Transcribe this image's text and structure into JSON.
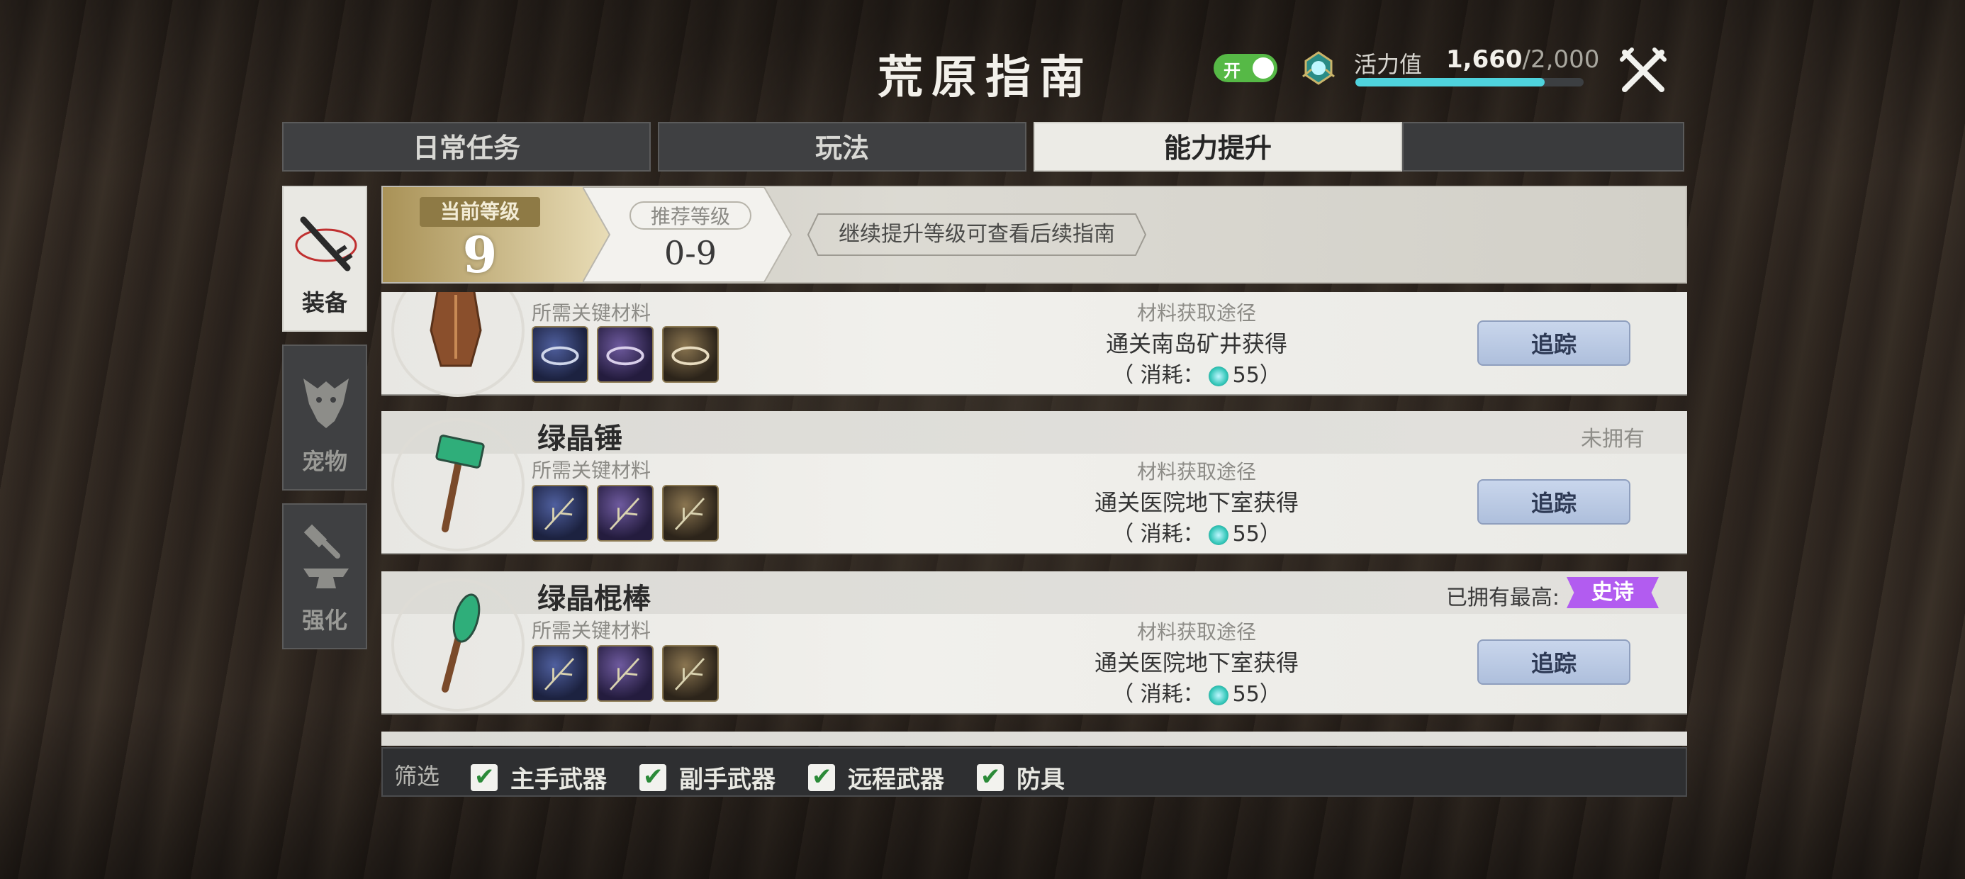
{
  "header": {
    "title": "荒原指南",
    "toggle_label": "开",
    "energy_label": "活力值",
    "energy_current": "1,660",
    "energy_max": "/2,000",
    "energy_fraction": 0.83,
    "icons": {
      "energy": "energy-crystal-icon",
      "close": "crossed-swords-close-icon"
    }
  },
  "tabs": [
    {
      "label": "日常任务",
      "active": false
    },
    {
      "label": "玩法",
      "active": false
    },
    {
      "label": "能力提升",
      "active": true
    }
  ],
  "side_nav": [
    {
      "label": "装备",
      "icon": "sword-icon",
      "active": true
    },
    {
      "label": "宠物",
      "icon": "wolf-icon",
      "active": false
    },
    {
      "label": "强化",
      "icon": "anvil-hammer-icon",
      "active": false
    }
  ],
  "level": {
    "current_label": "当前等级",
    "current_value": "9",
    "recommended_label": "推荐等级",
    "recommended_value": "0-9",
    "hint": "继续提升等级可查看后续指南"
  },
  "items": [
    {
      "name": "",
      "ownership": "",
      "req_label": "所需关键材料",
      "materials": [
        "blue",
        "purple",
        "gold"
      ],
      "source_label": "材料获取途径",
      "source": "通关南岛矿井获得",
      "cost_prefix": "（ 消耗：",
      "cost_value": "55",
      "cost_suffix": "）",
      "track": "追踪",
      "icon": "bracer-icon"
    },
    {
      "name": "绿晶锤",
      "ownership": "未拥有",
      "req_label": "所需关键材料",
      "materials": [
        "blue",
        "purple",
        "gold"
      ],
      "source_label": "材料获取途径",
      "source": "通关医院地下室获得",
      "cost_prefix": "（ 消耗：",
      "cost_value": "55",
      "cost_suffix": "）",
      "track": "追踪",
      "icon": "green-crystal-hammer-icon"
    },
    {
      "name": "绿晶棍棒",
      "ownership": "已拥有最高:",
      "rarity": "史诗",
      "req_label": "所需关键材料",
      "materials": [
        "blue",
        "purple",
        "gold"
      ],
      "source_label": "材料获取途径",
      "source": "通关医院地下室获得",
      "cost_prefix": "（ 消耗：",
      "cost_value": "55",
      "cost_suffix": "）",
      "track": "追踪",
      "icon": "green-crystal-club-icon"
    }
  ],
  "filter": {
    "label": "筛选",
    "options": [
      {
        "label": "主手武器",
        "checked": true
      },
      {
        "label": "副手武器",
        "checked": true
      },
      {
        "label": "远程武器",
        "checked": true
      },
      {
        "label": "防具",
        "checked": true
      }
    ]
  },
  "colors": {
    "toggle_on": "#56b946",
    "energy_bar": "#4fd3dd",
    "rarity_epic": "#b25cf0",
    "track_button": "#aebfdc",
    "current_level_gold": "#8e7a45"
  }
}
